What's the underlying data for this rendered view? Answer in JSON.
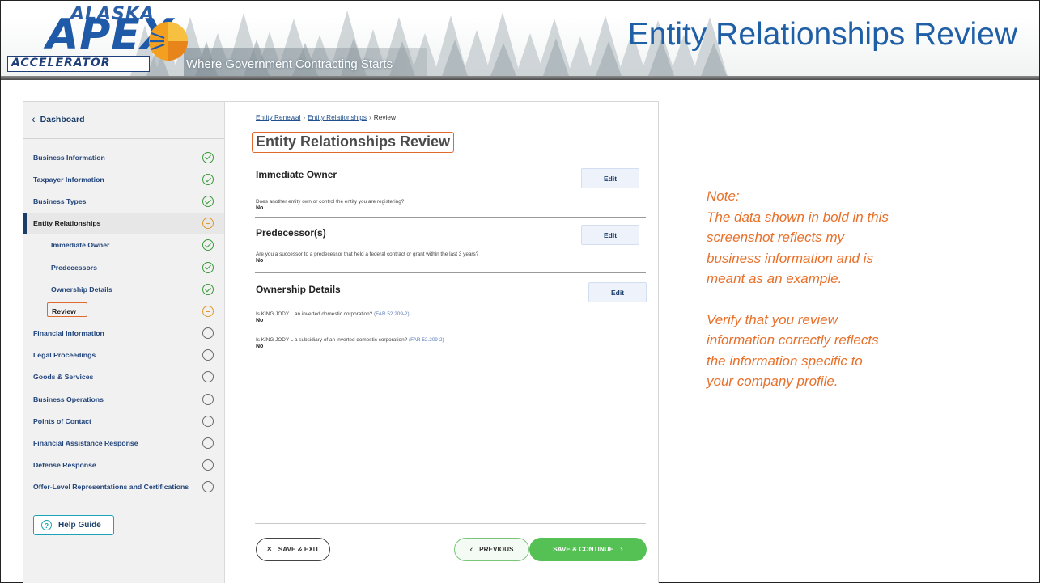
{
  "banner": {
    "logo_alaska": "ALASKA",
    "logo_apex": "APEX",
    "logo_accelerator": "ACCELERATOR",
    "tagline": "Where Government Contracting Starts",
    "slide_title": "Entity Relationships Review"
  },
  "sidebar": {
    "dashboard_label": "Dashboard",
    "items": [
      {
        "label": "Business Information",
        "status": "complete"
      },
      {
        "label": "Taxpayer Information",
        "status": "complete"
      },
      {
        "label": "Business Types",
        "status": "complete"
      },
      {
        "label": "Entity Relationships",
        "status": "in-progress"
      },
      {
        "label": "Immediate Owner",
        "status": "complete"
      },
      {
        "label": "Predecessors",
        "status": "complete"
      },
      {
        "label": "Ownership Details",
        "status": "complete"
      },
      {
        "label": "Review",
        "status": "in-progress"
      },
      {
        "label": "Financial Information",
        "status": "not-started"
      },
      {
        "label": "Legal Proceedings",
        "status": "not-started"
      },
      {
        "label": "Goods & Services",
        "status": "not-started"
      },
      {
        "label": "Business Operations",
        "status": "not-started"
      },
      {
        "label": "Points of Contact",
        "status": "not-started"
      },
      {
        "label": "Financial Assistance Response",
        "status": "not-started"
      },
      {
        "label": "Defense Response",
        "status": "not-started"
      },
      {
        "label": "Offer-Level Representations and Certifications",
        "status": "not-started"
      }
    ],
    "help_label": "Help Guide",
    "help_icon": "?"
  },
  "breadcrumb": {
    "items": [
      "Entity Renewal",
      "Entity Relationships",
      "Review"
    ],
    "separator": "›"
  },
  "main": {
    "title": "Entity Relationships Review",
    "sections": [
      {
        "heading": "Immediate Owner",
        "edit_label": "Edit",
        "question": "Does another entity own or control the entity you are registering?",
        "answer": "No"
      },
      {
        "heading": "Predecessor(s)",
        "edit_label": "Edit",
        "question": "Are you a successor to a predecessor that held a federal contract or grant within the last 3 years?",
        "answer": "No"
      },
      {
        "heading": "Ownership Details",
        "edit_label": "Edit",
        "questions": [
          {
            "text": "Is KING JODY L an inverted domestic corporation?",
            "ref": "(FAR 52.209-2)",
            "answer": "No"
          },
          {
            "text": "Is KING JODY L a subsidiary of an inverted domestic corporation?",
            "ref": "(FAR 52.209-2)",
            "answer": "No"
          }
        ]
      }
    ]
  },
  "footer": {
    "save_exit": "SAVE & EXIT",
    "previous": "PREVIOUS",
    "save_continue": "SAVE & CONTINUE"
  },
  "note": {
    "line1": "Note:",
    "line2": "The data shown in bold in this",
    "line3": "screenshot reflects my",
    "line4": "business information and is",
    "line5": "meant as an example.",
    "line6": "Verify that you review",
    "line7": "information correctly reflects",
    "line8": "the information specific to",
    "line9": "your company profile."
  },
  "colors": {
    "title_blue": "#1f5fa6",
    "note_orange": "#e8702a",
    "highlight_orange": "#e06a2c",
    "complete_green": "#3a9b3a",
    "progress_orange": "#e09a2a",
    "continue_green": "#55c155"
  }
}
